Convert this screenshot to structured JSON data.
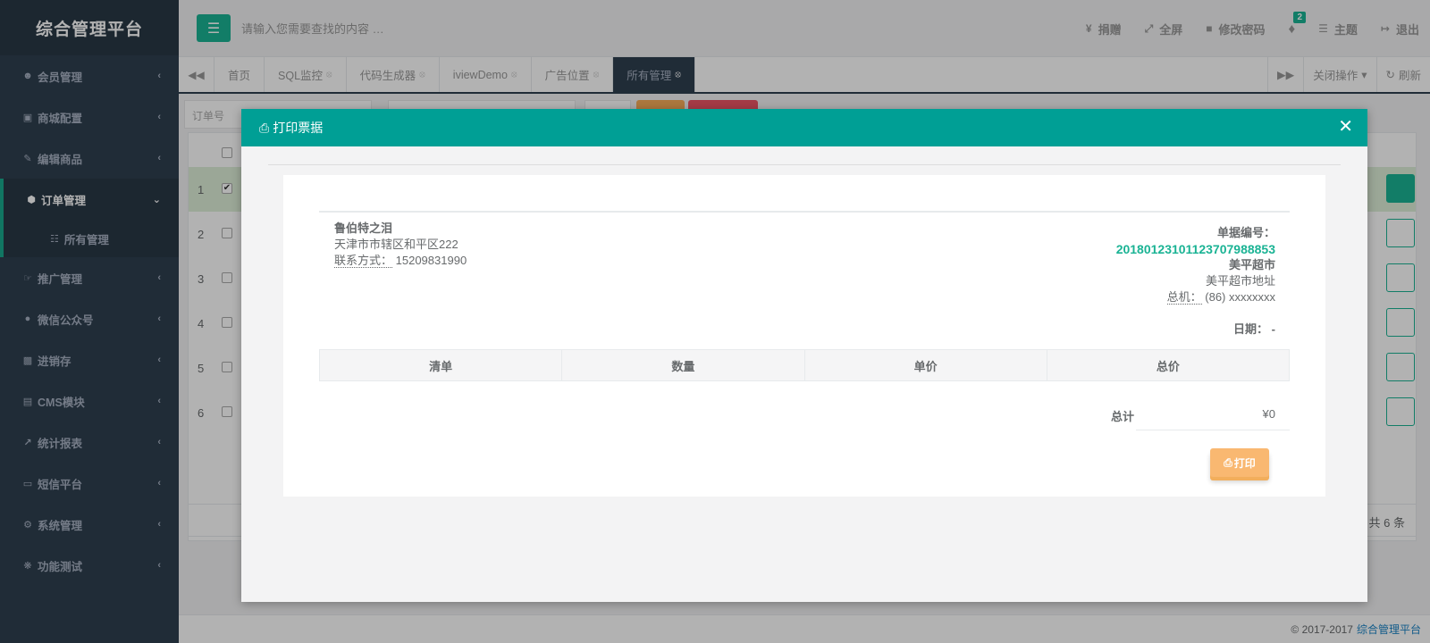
{
  "app": {
    "title": "综合管理平台"
  },
  "sidebar": {
    "items": [
      {
        "label": "会员管理",
        "icon": "user-circle-icon"
      },
      {
        "label": "商城配置",
        "icon": "cart-icon"
      },
      {
        "label": "编辑商品",
        "icon": "edit-icon"
      },
      {
        "label": "订单管理",
        "icon": "cube-icon",
        "active": true
      },
      {
        "label": "推广管理",
        "icon": "hand-icon"
      },
      {
        "label": "微信公众号",
        "icon": "wechat-icon"
      },
      {
        "label": "进销存",
        "icon": "truck-icon"
      },
      {
        "label": "CMS模块",
        "icon": "book-icon"
      },
      {
        "label": "统计报表",
        "icon": "line-chart-icon"
      },
      {
        "label": "短信平台",
        "icon": "desktop-icon"
      },
      {
        "label": "系统管理",
        "icon": "gear-icon"
      },
      {
        "label": "功能测试",
        "icon": "bug-icon"
      }
    ],
    "subitem": {
      "label": "所有管理",
      "icon": "sitemap-icon"
    }
  },
  "header": {
    "search_placeholder": "请输入您需要查找的内容 …",
    "links": {
      "donate": "捐赠",
      "fullscreen": "全屏",
      "password": "修改密码",
      "theme": "主题",
      "logout": "退出"
    },
    "notification_count": "2"
  },
  "tabs": {
    "items": [
      {
        "label": "首页",
        "closable": false
      },
      {
        "label": "SQL监控",
        "closable": true
      },
      {
        "label": "代码生成器",
        "closable": true
      },
      {
        "label": "iviewDemo",
        "closable": true
      },
      {
        "label": "广告位置",
        "closable": true
      },
      {
        "label": "所有管理",
        "closable": true,
        "active": true
      }
    ],
    "close_ops": "关闭操作",
    "refresh": "刷新"
  },
  "content": {
    "filter_order_placeholder": "订单号",
    "row_numbers": [
      "1",
      "2",
      "3",
      "4",
      "5",
      "6"
    ],
    "pager_text": "共 6 条"
  },
  "footer": {
    "copyright": "© 2017-2017",
    "link": "综合管理平台"
  },
  "modal": {
    "title": "打印票据",
    "seller": {
      "name": "鲁伯特之泪",
      "address": "天津市市辖区和平区222",
      "contact_label": "联系方式：",
      "contact_value": "15209831990"
    },
    "buyer": {
      "number_label": "单据编号：",
      "number_value": "20180123101123707988853",
      "name": "美平超市",
      "address": "美平超市地址",
      "phone_label": "总机：",
      "phone_value": "(86) xxxxxxxx",
      "date_label": "日期：",
      "date_value": "-"
    },
    "table_headers": [
      "清单",
      "数量",
      "单价",
      "总价"
    ],
    "total_label": "总计",
    "total_value": "¥0",
    "print_button": "打印"
  },
  "colors": {
    "sidebar_bg": "#2f4050",
    "accent": "#1ab394",
    "modal_header": "#009f95",
    "print_button": "#f8ac59"
  }
}
